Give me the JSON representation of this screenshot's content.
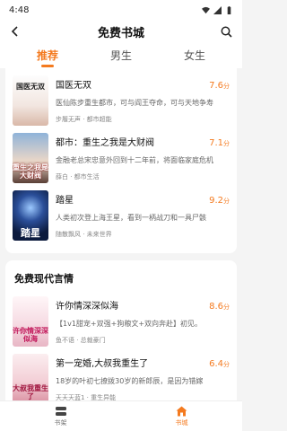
{
  "status": {
    "time": "4:48"
  },
  "header": {
    "title": "免费书城"
  },
  "tabs": [
    {
      "label": "推荐",
      "active": true
    },
    {
      "label": "男生",
      "active": false
    },
    {
      "label": "女生",
      "active": false
    }
  ],
  "recommend_books": [
    {
      "title": "国医无双",
      "score": "7.6",
      "unit": "分",
      "desc": "医仙陈步重生都市，可与阎王夺命，可与天地争寿",
      "meta": "步履无声 · 都市超能",
      "cover_text": "国医无双"
    },
    {
      "title": "都市：重生之我是大财阀",
      "score": "7.1",
      "unit": "分",
      "desc": "金融老总宋忠意外回到十二年前，将面临家庭危机",
      "meta": "薛白 · 都市生活",
      "cover_text": "重生之我是大财阀"
    },
    {
      "title": "踏星",
      "score": "9.2",
      "unit": "分",
      "desc": "人类初次登上海王星，看到一柄战刀和一具尸骸",
      "meta": "随散飘风 · 未来世界",
      "cover_text": "踏星"
    }
  ],
  "section": {
    "title": "免费现代言情"
  },
  "romance_books": [
    {
      "title": "许你情深深似海",
      "score": "8.6",
      "unit": "分",
      "desc": "【1v1甜宠+双强+狗粮文+双向奔赴】初见。",
      "meta": "鱼不语 · 总裁豪门",
      "cover_text": "许你情深深似海"
    },
    {
      "title": "第一宠婚,大叔我重生了",
      "score": "6.4",
      "unit": "分",
      "desc": "18岁的叶初七撩拨30岁的新郎辰，是因为错嫁",
      "meta": "天天天蓝1 · 重生异能",
      "cover_text": "大叔我重生了"
    }
  ],
  "bottom_nav": [
    {
      "label": "书架",
      "active": false
    },
    {
      "label": "书城",
      "active": true
    }
  ],
  "colors": {
    "accent": "#f47a1f"
  }
}
